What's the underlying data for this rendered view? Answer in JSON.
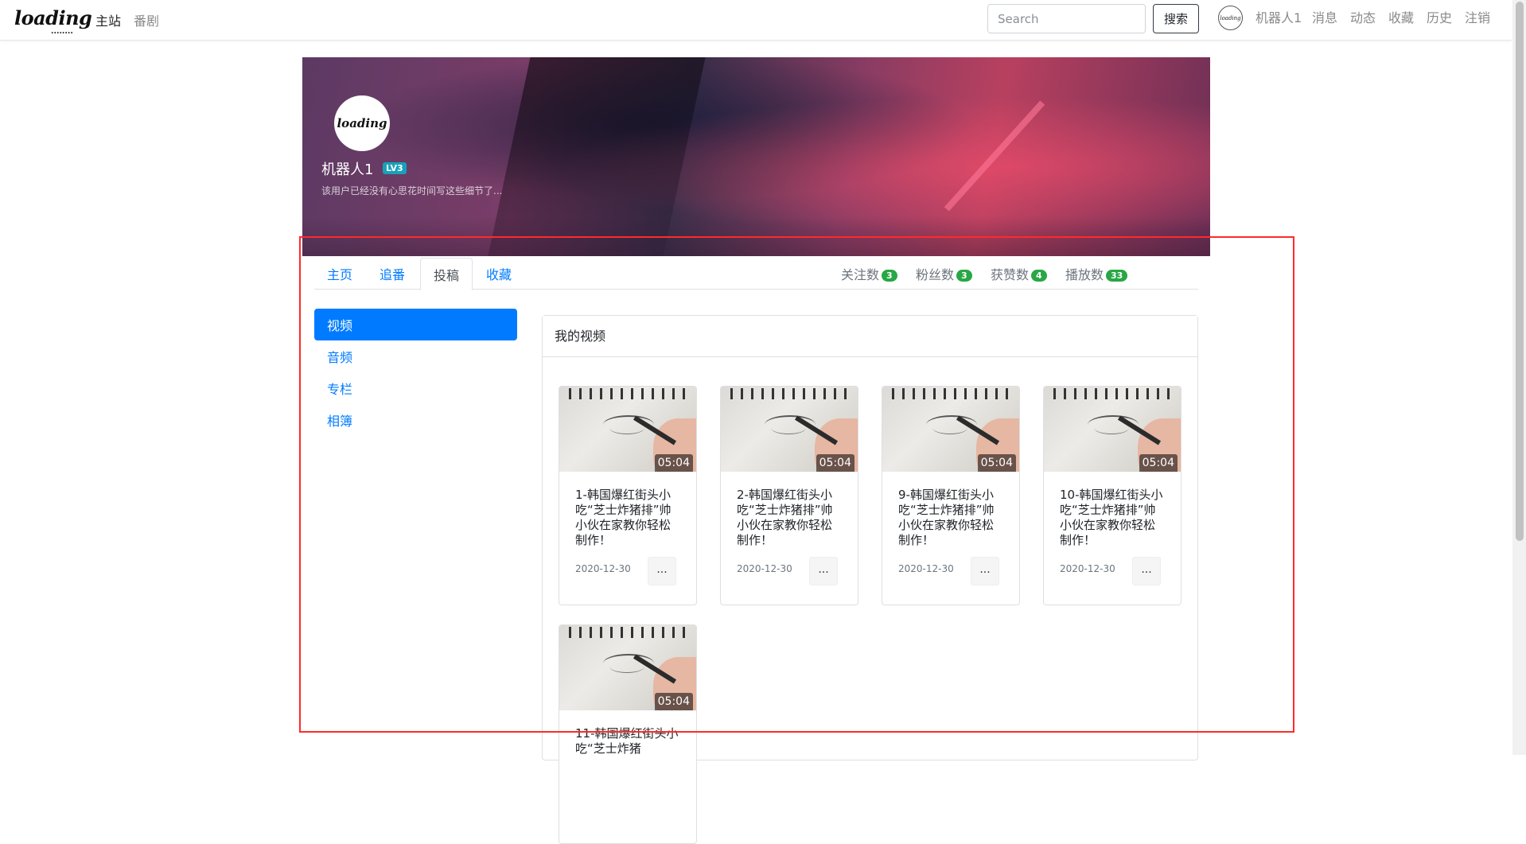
{
  "navbar": {
    "logo": "loading",
    "logo_dots": "........",
    "links": [
      "主站",
      "番剧"
    ],
    "search_placeholder": "Search",
    "search_button": "搜索",
    "avatar_text": "loading",
    "user_links": [
      "机器人1",
      "消息",
      "动态",
      "收藏",
      "历史",
      "注销"
    ]
  },
  "profile": {
    "avatar_text": "loading",
    "name": "机器人1",
    "level": "LV3",
    "bio": "该用户已经没有心思花时间写这些细节了..."
  },
  "tabs": {
    "items": [
      "主页",
      "追番",
      "投稿",
      "收藏"
    ],
    "active": "投稿"
  },
  "stats": [
    {
      "label": "关注数",
      "value": "3"
    },
    {
      "label": "粉丝数",
      "value": "3"
    },
    {
      "label": "获赞数",
      "value": "4"
    },
    {
      "label": "播放数",
      "value": "33"
    }
  ],
  "side_menu": {
    "items": [
      "视频",
      "音频",
      "专栏",
      "相簿"
    ],
    "active": "视频"
  },
  "panel": {
    "title": "我的视频"
  },
  "videos": [
    {
      "title": "1-韩国爆红街头小吃“芝士炸猪排”帅小伙在家教你轻松制作！",
      "duration": "05:04",
      "date": "2020-12-30",
      "more": "..."
    },
    {
      "title": "2-韩国爆红街头小吃“芝士炸猪排”帅小伙在家教你轻松制作！",
      "duration": "05:04",
      "date": "2020-12-30",
      "more": "..."
    },
    {
      "title": "9-韩国爆红街头小吃“芝士炸猪排”帅小伙在家教你轻松制作！",
      "duration": "05:04",
      "date": "2020-12-30",
      "more": "..."
    },
    {
      "title": "10-韩国爆红街头小吃“芝士炸猪排”帅小伙在家教你轻松制作！",
      "duration": "05:04",
      "date": "2020-12-30",
      "more": "..."
    },
    {
      "title": "11-韩国爆红街头小吃“芝士炸猪",
      "duration": "05:04",
      "date": "",
      "more": ""
    }
  ],
  "colors": {
    "primary": "#007bff",
    "badge_green": "#28a745",
    "level_badge": "#17a2b8",
    "highlight": "#ff2a2a"
  }
}
